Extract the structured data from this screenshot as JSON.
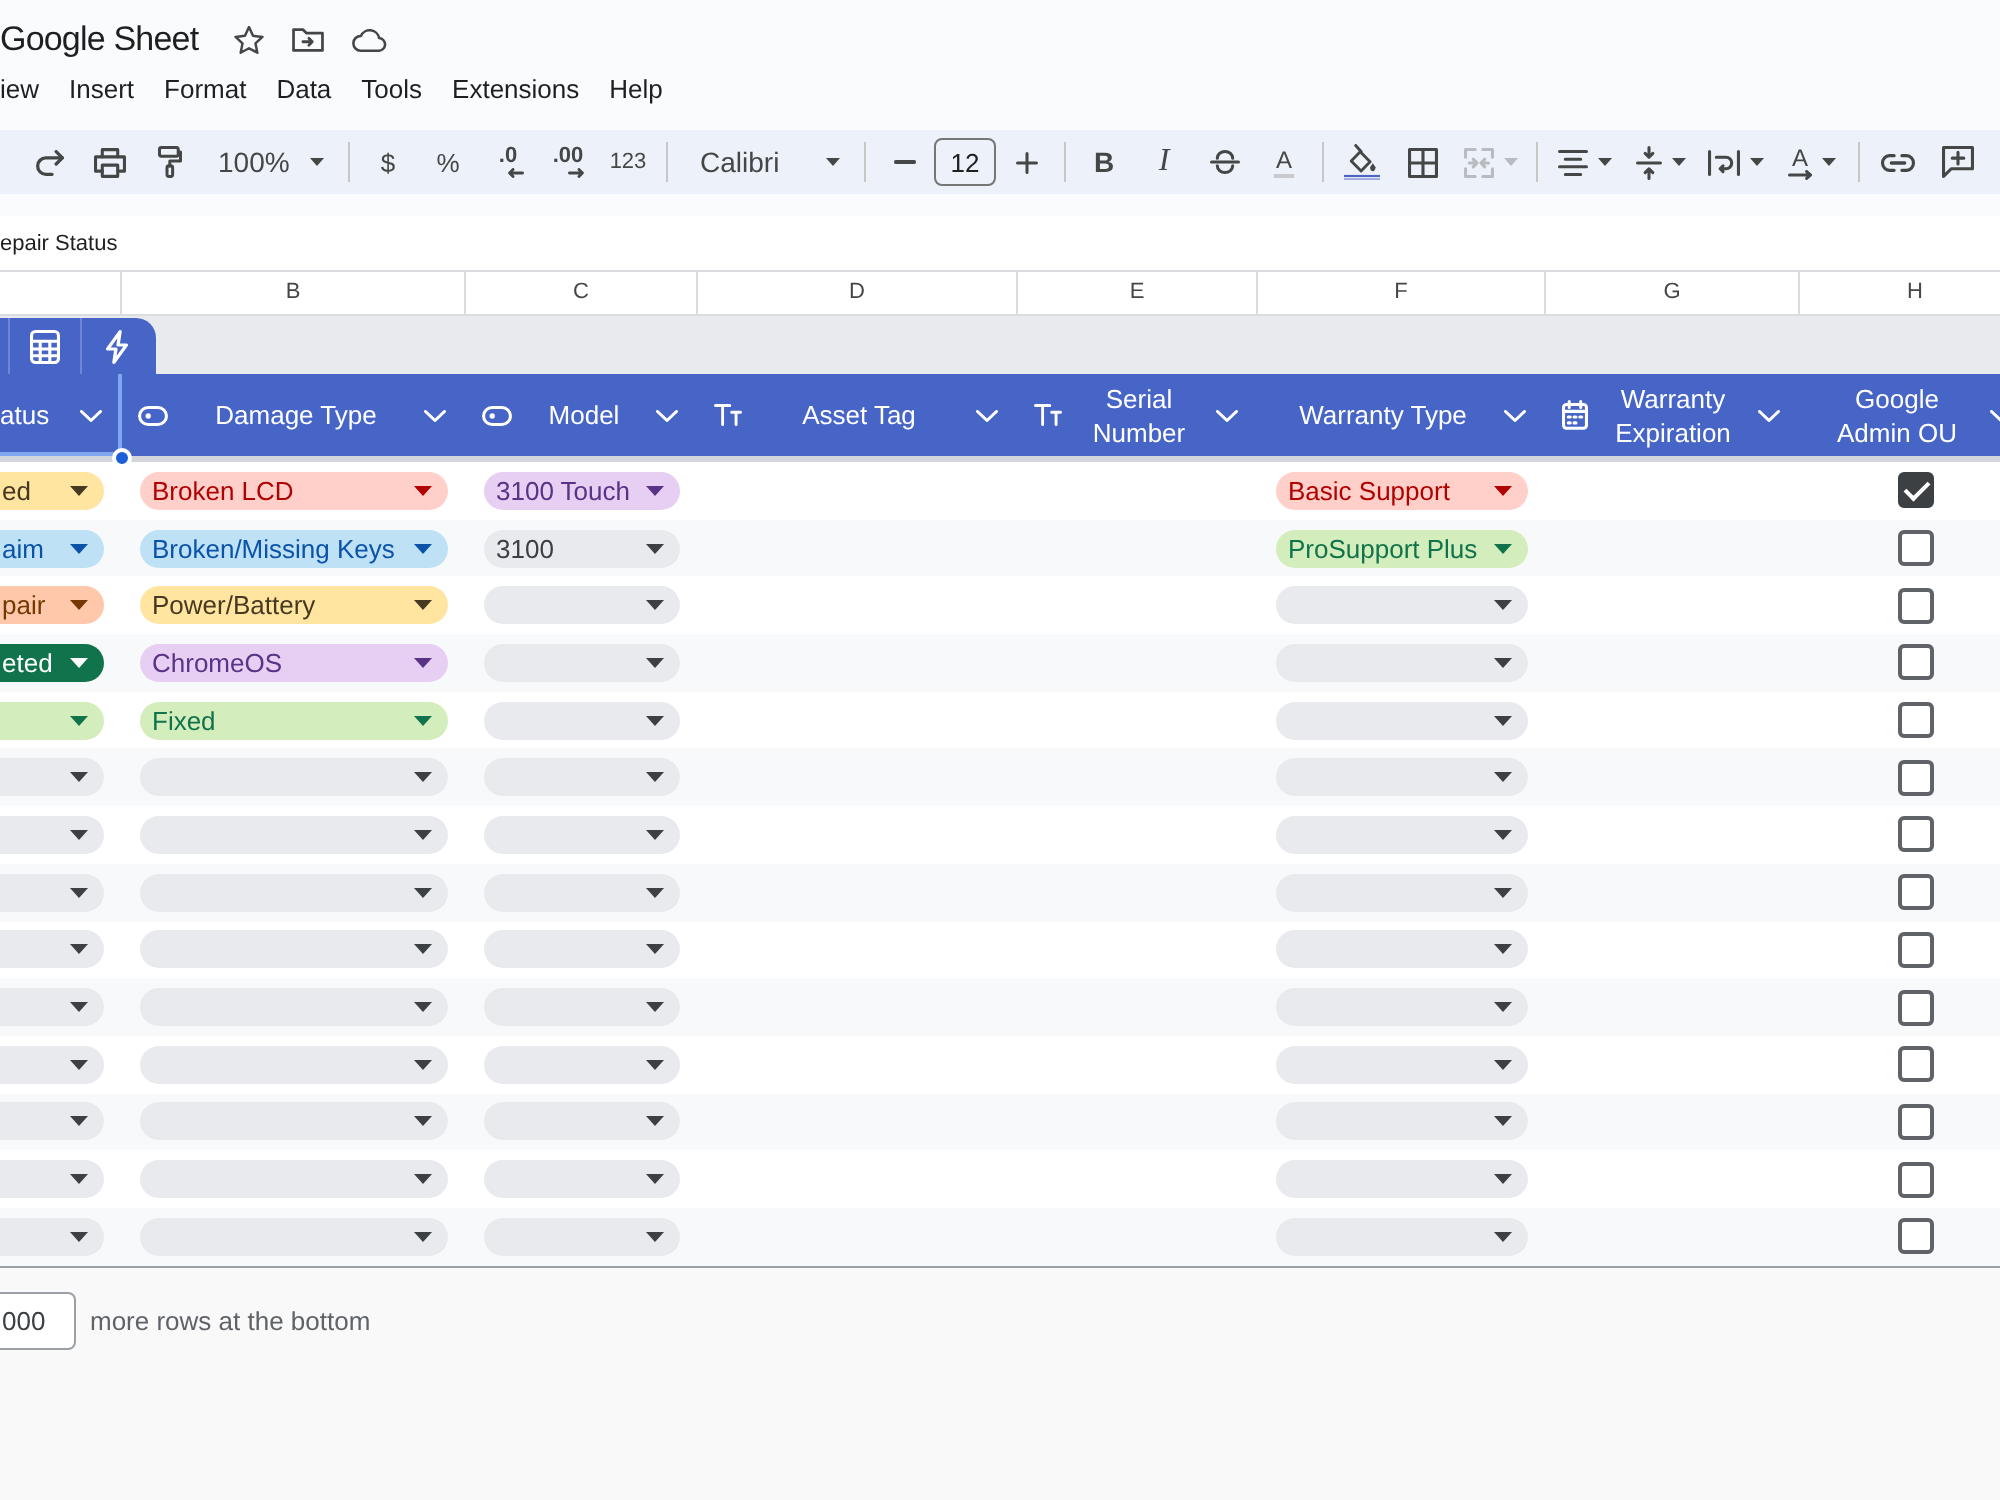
{
  "document": {
    "title": "Google Sheet"
  },
  "menu": [
    "iew",
    "Insert",
    "Format",
    "Data",
    "Tools",
    "Extensions",
    "Help"
  ],
  "toolbar": {
    "zoom": "100%",
    "currency": "$",
    "percent": "%",
    "decrease_decimals": ".0",
    "increase_decimals": ".00",
    "number_format": "123",
    "font": "Calibri",
    "font_size": "12",
    "bold": "B",
    "italic": "I",
    "text_color": "A",
    "merge": {
      "disabled": true
    },
    "text_rotation": "A"
  },
  "formula_bar": {
    "value": "epair Status"
  },
  "column_letters": [
    "B",
    "C",
    "D",
    "E",
    "F",
    "G",
    "H"
  ],
  "table": {
    "columns": [
      {
        "title": "atus",
        "kind": "dropdown",
        "icon_shown": false,
        "selected": true
      },
      {
        "title": "Damage Type",
        "kind": "dropdown",
        "icon_shown": true,
        "selected": false
      },
      {
        "title": "Model",
        "kind": "dropdown",
        "icon_shown": true,
        "selected": false
      },
      {
        "title": "Asset Tag",
        "kind": "text",
        "icon_shown": true,
        "selected": false
      },
      {
        "title": "Serial Number",
        "kind": "text",
        "icon_shown": true,
        "selected": false
      },
      {
        "title": "Warranty Type",
        "kind": "dropdown",
        "icon_shown": false,
        "selected": false
      },
      {
        "title": "Warranty Expiration",
        "kind": "date",
        "icon_shown": true,
        "selected": false
      },
      {
        "title": "Google Admin OU",
        "kind": "checkbox",
        "icon_shown": false,
        "selected": false
      }
    ],
    "rows": [
      {
        "cells": [
          {
            "label": "ed",
            "color": "#ffe5a0"
          },
          {
            "label": "Broken LCD",
            "color": "#ffcfc9"
          },
          {
            "label": "3100 Touch",
            "color": "#e6cff2"
          },
          null,
          null,
          {
            "label": "Basic Support",
            "color": "#ffcfc9"
          },
          null,
          {
            "checked": true
          }
        ]
      },
      {
        "cells": [
          {
            "label": "aim",
            "color": "#bfe1f6"
          },
          {
            "label": "Broken/Missing Keys",
            "color": "#bfe1f6"
          },
          {
            "label": "3100",
            "color": "#e8eaed"
          },
          null,
          null,
          {
            "label": "ProSupport Plus",
            "color": "#d4edbc"
          },
          null,
          {
            "checked": false
          }
        ]
      },
      {
        "cells": [
          {
            "label": "pair",
            "color": "#ffc8aa"
          },
          {
            "label": "Power/Battery",
            "color": "#ffe5a0"
          },
          {
            "color": "#e8eaed"
          },
          null,
          null,
          {
            "color": "#e8eaed"
          },
          null,
          {
            "checked": false
          }
        ]
      },
      {
        "cells": [
          {
            "label": "eted",
            "color": "#11734b"
          },
          {
            "label": "ChromeOS",
            "color": "#e6cff2"
          },
          {
            "color": "#e8eaed"
          },
          null,
          null,
          {
            "color": "#e8eaed"
          },
          null,
          {
            "checked": false
          }
        ]
      },
      {
        "cells": [
          {
            "color": "#d4edbc"
          },
          {
            "label": "Fixed",
            "color": "#d4edbc"
          },
          {
            "color": "#e8eaed"
          },
          null,
          null,
          {
            "color": "#e8eaed"
          },
          null,
          {
            "checked": false
          }
        ]
      },
      {
        "cells": [
          {
            "color": "#e8eaed"
          },
          {
            "color": "#e8eaed"
          },
          {
            "color": "#e8eaed"
          },
          null,
          null,
          {
            "color": "#e8eaed"
          },
          null,
          {
            "checked": false
          }
        ]
      },
      {
        "cells": [
          {
            "color": "#e8eaed"
          },
          {
            "color": "#e8eaed"
          },
          {
            "color": "#e8eaed"
          },
          null,
          null,
          {
            "color": "#e8eaed"
          },
          null,
          {
            "checked": false
          }
        ]
      },
      {
        "cells": [
          {
            "color": "#e8eaed"
          },
          {
            "color": "#e8eaed"
          },
          {
            "color": "#e8eaed"
          },
          null,
          null,
          {
            "color": "#e8eaed"
          },
          null,
          {
            "checked": false
          }
        ]
      },
      {
        "cells": [
          {
            "color": "#e8eaed"
          },
          {
            "color": "#e8eaed"
          },
          {
            "color": "#e8eaed"
          },
          null,
          null,
          {
            "color": "#e8eaed"
          },
          null,
          {
            "checked": false
          }
        ]
      },
      {
        "cells": [
          {
            "color": "#e8eaed"
          },
          {
            "color": "#e8eaed"
          },
          {
            "color": "#e8eaed"
          },
          null,
          null,
          {
            "color": "#e8eaed"
          },
          null,
          {
            "checked": false
          }
        ]
      },
      {
        "cells": [
          {
            "color": "#e8eaed"
          },
          {
            "color": "#e8eaed"
          },
          {
            "color": "#e8eaed"
          },
          null,
          null,
          {
            "color": "#e8eaed"
          },
          null,
          {
            "checked": false
          }
        ]
      },
      {
        "cells": [
          {
            "color": "#e8eaed"
          },
          {
            "color": "#e8eaed"
          },
          {
            "color": "#e8eaed"
          },
          null,
          null,
          {
            "color": "#e8eaed"
          },
          null,
          {
            "checked": false
          }
        ]
      },
      {
        "cells": [
          {
            "color": "#e8eaed"
          },
          {
            "color": "#e8eaed"
          },
          {
            "color": "#e8eaed"
          },
          null,
          null,
          {
            "color": "#e8eaed"
          },
          null,
          {
            "checked": false
          }
        ]
      },
      {
        "cells": [
          {
            "color": "#e8eaed"
          },
          {
            "color": "#e8eaed"
          },
          {
            "color": "#e8eaed"
          },
          null,
          null,
          {
            "color": "#e8eaed"
          },
          null,
          {
            "checked": false
          }
        ]
      }
    ]
  },
  "footer": {
    "row_count": "000",
    "label": "more rows at the bottom"
  }
}
